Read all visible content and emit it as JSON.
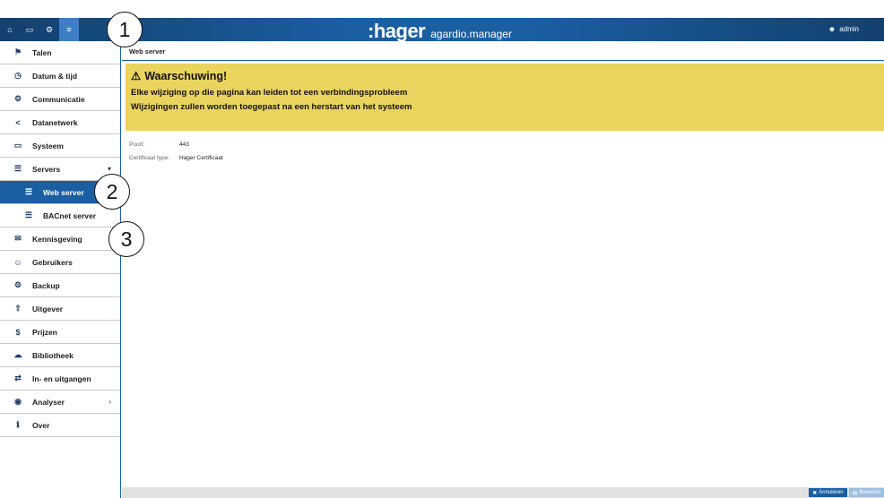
{
  "topbar": {
    "tabs": [
      {
        "icon": "home-icon",
        "glyph": "⌂"
      },
      {
        "icon": "monitor-icon",
        "glyph": "▭"
      },
      {
        "icon": "cogs-icon",
        "glyph": "⚙"
      },
      {
        "icon": "sliders-icon",
        "glyph": "≡"
      }
    ],
    "brand_logo": ":hager",
    "brand_product": "agardio.manager",
    "user_label": "admin"
  },
  "sidebar": {
    "items": [
      {
        "label": "Talen",
        "icon": "flag-icon",
        "glyph": "⚑"
      },
      {
        "label": "Datum & tijd",
        "icon": "clock-icon",
        "glyph": "◷"
      },
      {
        "label": "Communicatie",
        "icon": "cogs-icon",
        "glyph": "⚙"
      },
      {
        "label": "Datanetwerk",
        "icon": "share-icon",
        "glyph": "<"
      },
      {
        "label": "Systeem",
        "icon": "hdd-icon",
        "glyph": "▭"
      },
      {
        "label": "Servers",
        "icon": "server-icon",
        "glyph": "☰",
        "caret": "▾"
      },
      {
        "label": "Web server",
        "icon": "server-icon",
        "glyph": "☰"
      },
      {
        "label": "BACnet server",
        "icon": "server-icon",
        "glyph": "☰"
      },
      {
        "label": "Kennisgeving",
        "icon": "envelope-icon",
        "glyph": "✉"
      },
      {
        "label": "Gebruikers",
        "icon": "users-icon",
        "glyph": "☺"
      },
      {
        "label": "Backup",
        "icon": "cogs-icon",
        "glyph": "⚙"
      },
      {
        "label": "Uitgever",
        "icon": "upload-icon",
        "glyph": "⇧"
      },
      {
        "label": "Prijzen",
        "icon": "dollar-icon",
        "glyph": "$"
      },
      {
        "label": "Bibliotheek",
        "icon": "cloud-upload-icon",
        "glyph": "☁"
      },
      {
        "label": "In- en uitgangen",
        "icon": "exchange-icon",
        "glyph": "⇄"
      },
      {
        "label": "Analyser",
        "icon": "eye-icon",
        "glyph": "◉",
        "caret": "›"
      },
      {
        "label": "Over",
        "icon": "info-icon",
        "glyph": "ℹ"
      }
    ]
  },
  "main": {
    "breadcrumb": "Web server",
    "warning": {
      "title": "Waarschuwing!",
      "line1": "Elke wijziging op die pagina kan leiden tot een verbindingsprobleem",
      "line2": "Wijzigingen zullen worden toegepast na een herstart van het systeem"
    },
    "properties": [
      {
        "key": "Poort:",
        "value": "443"
      },
      {
        "key": "Certificaat type:",
        "value": "Hager Certificaat"
      }
    ]
  },
  "footer": {
    "cancel_label": "Annuleren",
    "save_label": "Bewaren"
  },
  "callouts": [
    "1",
    "2",
    "3"
  ]
}
